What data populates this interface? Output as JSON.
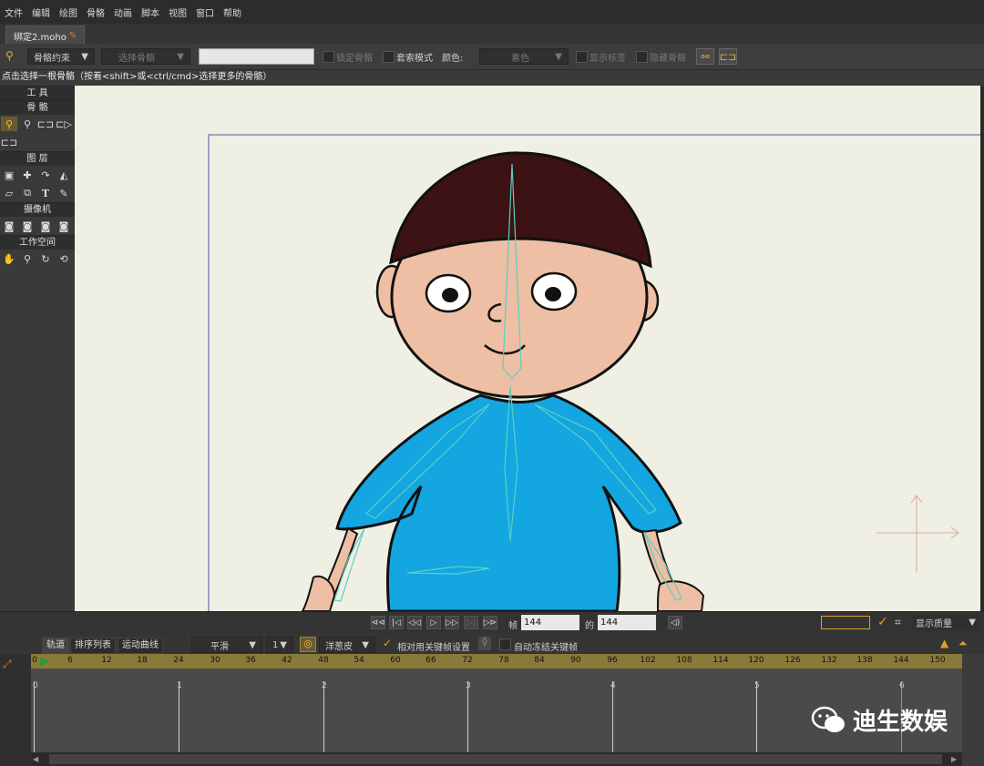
{
  "menu": [
    "文件",
    "编辑",
    "绘图",
    "骨骼",
    "动画",
    "脚本",
    "视图",
    "窗口",
    "帮助"
  ],
  "doc_tab": {
    "title": "绑定2.moho"
  },
  "options": {
    "bone_constraint": "骨骼约束",
    "select_bone": "选择骨骼",
    "lock_bone": "锁定骨骼",
    "lasso_mode": "套索模式",
    "color_label": "颜色:",
    "color_value": "素色",
    "show_labels": "显示标签",
    "hide_bones": "隐藏骨骼"
  },
  "hint": "点击选择一根骨骼（按着<shift>或<ctrl/cmd>选择更多的骨骼）",
  "toolbox": {
    "tools_header": "工 具",
    "bones_header": "骨 骼",
    "layers_header": "图 层",
    "camera_header": "摄像机",
    "workspace_header": "工作空间"
  },
  "playbar": {
    "frame_label": "帧",
    "frame_value": "144",
    "of_label": "的",
    "total_value": "144",
    "quality": "显示质量"
  },
  "timeline": {
    "tabs": [
      "轨道",
      "排序列表",
      "运动曲线"
    ],
    "interp": "平滑",
    "interp_num": "1",
    "onion": "洋葱皮",
    "relative_keys": "相对用关键帧设置",
    "auto_freeze": "自动冻结关键帧",
    "ruler": [
      "0",
      "6",
      "12",
      "18",
      "24",
      "30",
      "36",
      "42",
      "48",
      "54",
      "60",
      "66",
      "72",
      "78",
      "84",
      "90",
      "96",
      "102",
      "108",
      "114",
      "120",
      "126",
      "132",
      "138",
      "144",
      "150"
    ],
    "seconds": [
      "0",
      "1",
      "2",
      "3",
      "4",
      "5",
      "6"
    ]
  },
  "watermark": "迪生数娱",
  "colors": {
    "accent": "#e0a020",
    "canvas": "#f0efe3",
    "shirt": "#13a6e0",
    "hair": "#3c1214",
    "skin": "#eebfa4"
  }
}
